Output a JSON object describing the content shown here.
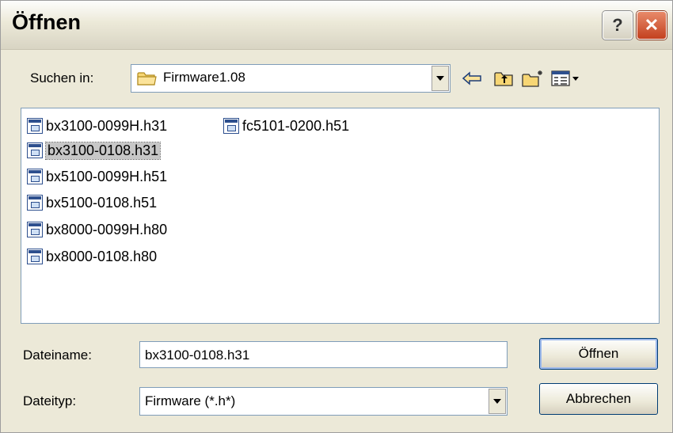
{
  "window": {
    "title": "Öffnen"
  },
  "titlebar": {
    "help_glyph": "?",
    "close_glyph": "✕"
  },
  "location": {
    "label": "Suchen in:",
    "folder": "Firmware1.08",
    "tools": [
      "back-arrow-icon",
      "up-folder-icon",
      "new-folder-icon",
      "view-menu-icon"
    ]
  },
  "files": [
    {
      "name": "bx3100-0099H.h31",
      "selected": false
    },
    {
      "name": "bx3100-0108.h31",
      "selected": true
    },
    {
      "name": "bx5100-0099H.h51",
      "selected": false
    },
    {
      "name": "bx5100-0108.h51",
      "selected": false
    },
    {
      "name": "bx8000-0099H.h80",
      "selected": false
    },
    {
      "name": "bx8000-0108.h80",
      "selected": false
    },
    {
      "name": "fc5101-0200.h51",
      "selected": false
    }
  ],
  "filename": {
    "label": "Dateiname:",
    "value": "bx3100-0108.h31"
  },
  "filetype": {
    "label": "Dateityp:",
    "value": "Firmware (*.h*)"
  },
  "buttons": {
    "open": "Öffnen",
    "cancel": "Abbrechen"
  }
}
